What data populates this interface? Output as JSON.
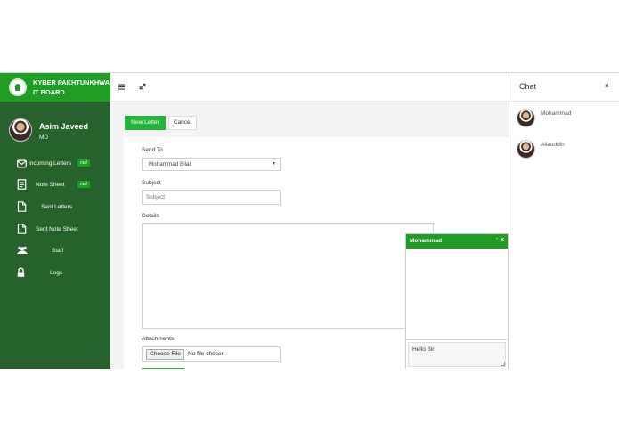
{
  "brand": {
    "line1": "KYBER PAKHTUNKHWA",
    "line2": "IT BOARD",
    "logo_icon": "kpitb-logo-icon",
    "color": "#1f9e23"
  },
  "user": {
    "name": "Asim Javeed",
    "role": "MD"
  },
  "sidebar": {
    "background": "#27612b",
    "items": [
      {
        "label": "Incoming Letters",
        "icon": "envelope-icon",
        "badge": "null"
      },
      {
        "label": "Note Sheet",
        "icon": "document-icon",
        "badge": "null"
      },
      {
        "label": "Sent Letters",
        "icon": "file-icon"
      },
      {
        "label": "Sent Note Sheet",
        "icon": "file-icon"
      },
      {
        "label": "Staff",
        "icon": "users-icon"
      },
      {
        "label": "Logs",
        "icon": "lock-icon"
      }
    ]
  },
  "topbar": {
    "menu_icon": "hamburger-icon",
    "expand_icon": "expand-icon"
  },
  "actions": {
    "new_letter": "New Letter",
    "cancel": "Cancel"
  },
  "form": {
    "send_to_label": "Send To",
    "send_to_value": "Mohammad Bilal",
    "subject_label": "Subject",
    "subject_placeholder": "Subject",
    "details_label": "Details",
    "attachments_label": "Attachments",
    "choose_file": "Choose File",
    "no_file": "No file chosen"
  },
  "chat": {
    "title": "Chat",
    "close": "×",
    "contacts": [
      {
        "name": "Mohammad"
      },
      {
        "name": "Allauddin"
      }
    ]
  },
  "chat_window": {
    "title": "Mohammad",
    "minimize": "-",
    "close": "x",
    "message_draft": "Hello Sir"
  }
}
